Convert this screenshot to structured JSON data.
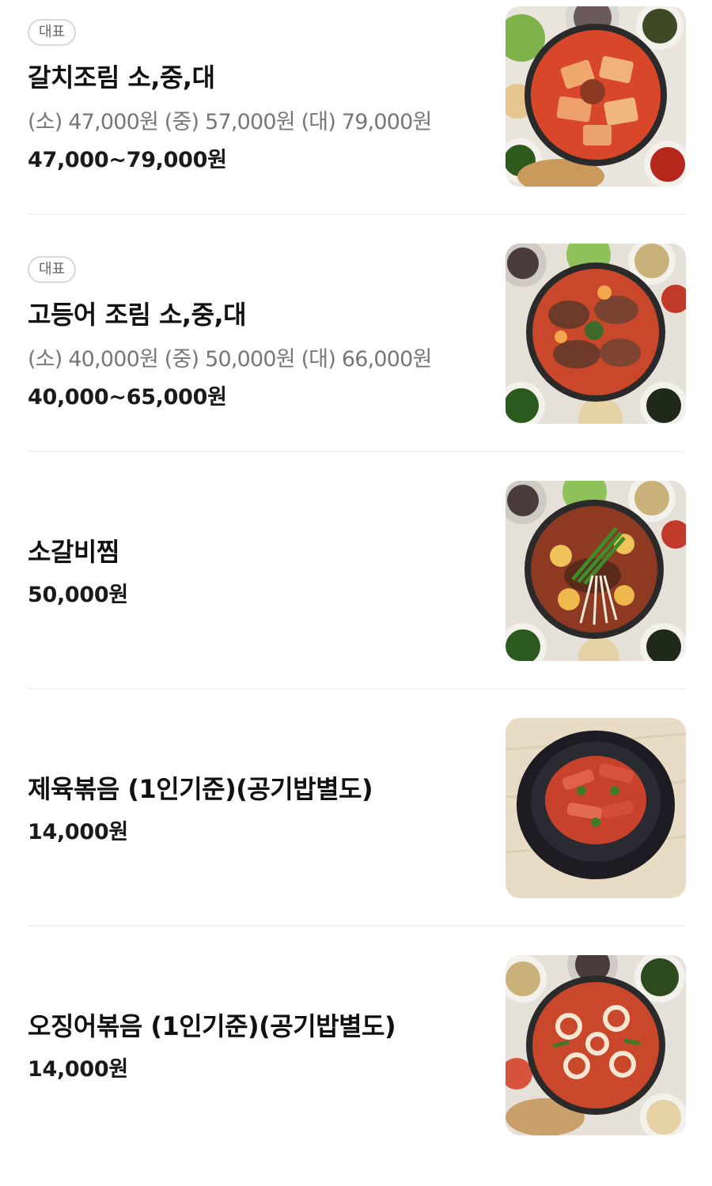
{
  "menu": {
    "items": [
      {
        "badge": "대표",
        "name": "갈치조림 소,중,대",
        "description": "(소) 47,000원 (중) 57,000원 (대) 79,000원",
        "price": "47,000~79,000원",
        "image": "braised-cutlassfish-photo"
      },
      {
        "badge": "대표",
        "name": "고등어 조림 소,중,대",
        "description": "(소) 40,000원 (중) 50,000원 (대) 66,000원",
        "price": "40,000~65,000원",
        "image": "braised-mackerel-photo"
      },
      {
        "name": "소갈비찜",
        "price": "50,000원",
        "image": "braised-short-ribs-photo"
      },
      {
        "name": "제육볶음 (1인기준)(공기밥별도)",
        "price": "14,000원",
        "image": "spicy-pork-stirfry-photo"
      },
      {
        "name": "오징어볶음 (1인기준)(공기밥별도)",
        "price": "14,000원",
        "image": "spicy-squid-stirfry-photo"
      }
    ]
  }
}
